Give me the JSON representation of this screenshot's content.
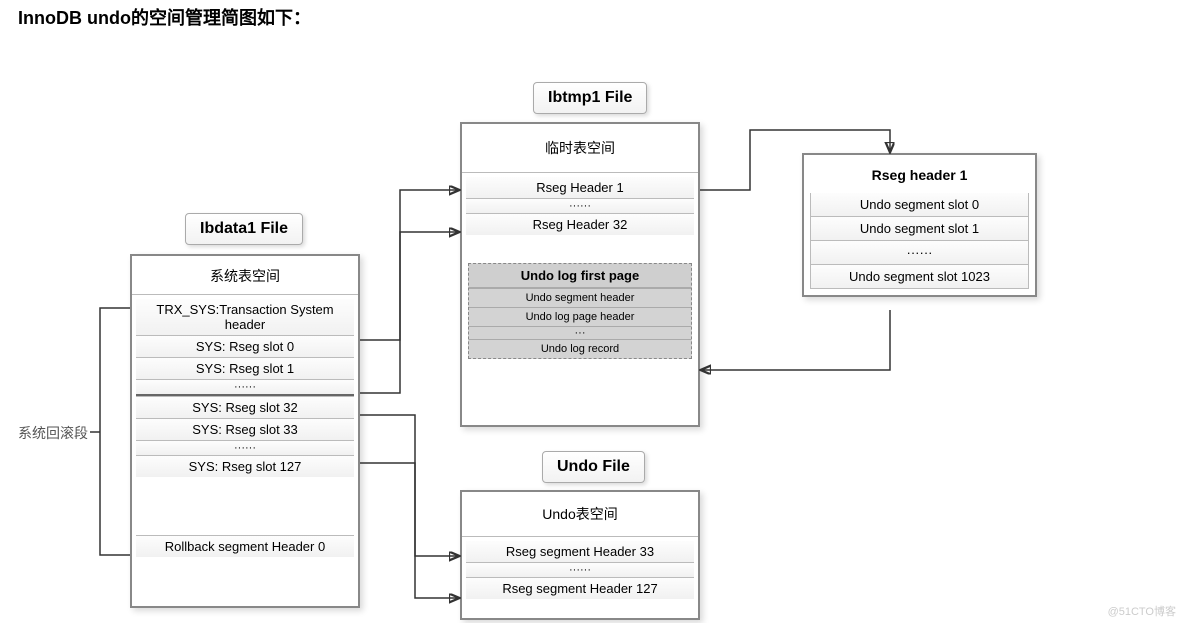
{
  "title": "InnoDB undo的空间管理简图如下：",
  "caption_rollback": "系统回滚段",
  "labels": {
    "ibdata1": "Ibdata1 File",
    "ibtmp1": "Ibtmp1 File",
    "undofile": "Undo File"
  },
  "ibdata1": {
    "header": "系统表空间",
    "rows": [
      "TRX_SYS:Transaction System header",
      "SYS: Rseg slot 0",
      "SYS: Rseg slot 1",
      "······",
      "SYS: Rseg slot 32",
      "SYS: Rseg slot 33",
      "······",
      "SYS: Rseg slot 127"
    ],
    "footer": "Rollback segment Header 0"
  },
  "ibtmp1": {
    "header": "临时表空间",
    "rows": [
      "Rseg Header  1",
      "······",
      "Rseg Header  32"
    ],
    "undo_group": {
      "title": "Undo log first page",
      "rows": [
        "Undo segment header",
        "Undo log  page header",
        "···",
        "Undo log record"
      ]
    }
  },
  "undofile": {
    "header": "Undo表空间",
    "rows": [
      "Rseg segment Header  33",
      "······",
      "Rseg segment Header  127"
    ]
  },
  "rseg": {
    "title": "Rseg header 1",
    "rows": [
      "Undo segment  slot 0",
      "Undo segment  slot 1",
      "······",
      "Undo segment  slot 1023"
    ]
  },
  "watermark": "@51CTO博客"
}
